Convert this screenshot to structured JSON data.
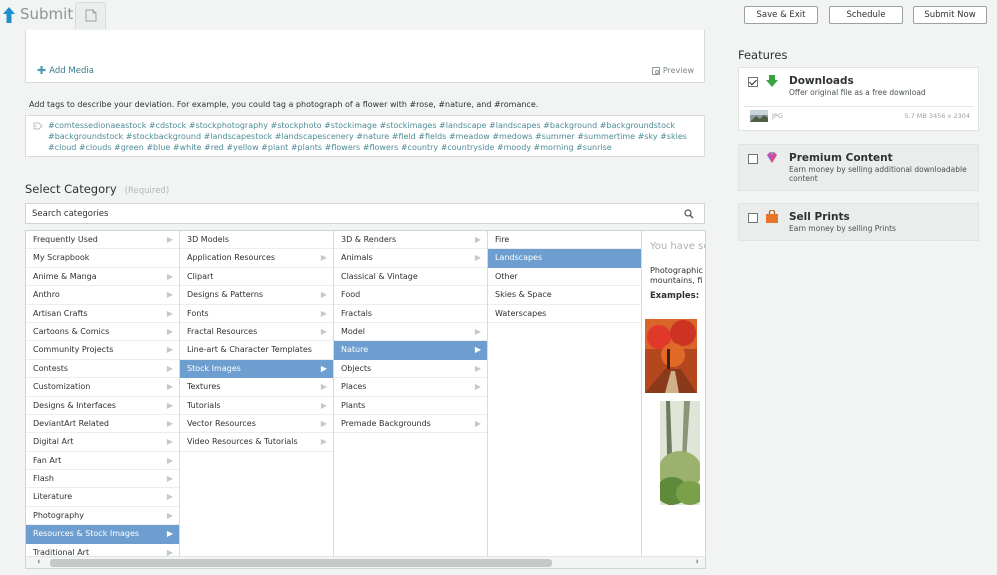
{
  "header": {
    "title": "Submit",
    "buttons": {
      "save_exit": "Save & Exit",
      "schedule": "Schedule",
      "submit_now": "Submit Now"
    }
  },
  "editor": {
    "add_media": "Add Media",
    "preview": "Preview"
  },
  "tags": {
    "hint": "Add tags to describe your deviation. For example, you could tag a photograph of a flower with #rose, #nature, and #romance.",
    "text": "#comtessedionaeastock #cdstock #stockphotography #stockphoto #stockimage #stockimages #landscape #landscapes #background #backgroundstock #backgroundstock #stockbackground #landscapestock #landscapescenery #nature #field #fields #meadow #medows #summer #summertime #sky #skies #cloud #clouds #green #blue #white #red #yellow #plant #plants #flowers #flowers #country #countryside #moody #morning #sunrise"
  },
  "category": {
    "title": "Select Category",
    "required": "(Required)",
    "search_placeholder": "Search categories",
    "col1": [
      {
        "label": "Frequently Used",
        "arrow": true
      },
      {
        "label": "My Scrapbook",
        "arrow": false
      },
      {
        "label": "Anime & Manga",
        "arrow": true
      },
      {
        "label": "Anthro",
        "arrow": true
      },
      {
        "label": "Artisan Crafts",
        "arrow": true
      },
      {
        "label": "Cartoons & Comics",
        "arrow": true
      },
      {
        "label": "Community Projects",
        "arrow": true
      },
      {
        "label": "Contests",
        "arrow": true
      },
      {
        "label": "Customization",
        "arrow": true
      },
      {
        "label": "Designs & Interfaces",
        "arrow": true
      },
      {
        "label": "DeviantArt Related",
        "arrow": true
      },
      {
        "label": "Digital Art",
        "arrow": true
      },
      {
        "label": "Fan Art",
        "arrow": true
      },
      {
        "label": "Flash",
        "arrow": true
      },
      {
        "label": "Literature",
        "arrow": true
      },
      {
        "label": "Photography",
        "arrow": true
      },
      {
        "label": "Resources & Stock Images",
        "arrow": true,
        "selected": true
      },
      {
        "label": "Traditional Art",
        "arrow": true
      }
    ],
    "col2": [
      {
        "label": "3D Models",
        "arrow": false
      },
      {
        "label": "Application Resources",
        "arrow": true
      },
      {
        "label": "Clipart",
        "arrow": false
      },
      {
        "label": "Designs & Patterns",
        "arrow": true
      },
      {
        "label": "Fonts",
        "arrow": true
      },
      {
        "label": "Fractal Resources",
        "arrow": true
      },
      {
        "label": "Line-art & Character Templates",
        "arrow": false
      },
      {
        "label": "Stock Images",
        "arrow": true,
        "selected": true
      },
      {
        "label": "Textures",
        "arrow": true
      },
      {
        "label": "Tutorials",
        "arrow": true
      },
      {
        "label": "Vector Resources",
        "arrow": true
      },
      {
        "label": "Video Resources & Tutorials",
        "arrow": true
      }
    ],
    "col3": [
      {
        "label": "3D & Renders",
        "arrow": true
      },
      {
        "label": "Animals",
        "arrow": true
      },
      {
        "label": "Classical & Vintage",
        "arrow": false
      },
      {
        "label": "Food",
        "arrow": false
      },
      {
        "label": "Fractals",
        "arrow": false
      },
      {
        "label": "Model",
        "arrow": true
      },
      {
        "label": "Nature",
        "arrow": true,
        "selected": true
      },
      {
        "label": "Objects",
        "arrow": true
      },
      {
        "label": "Places",
        "arrow": true
      },
      {
        "label": "Plants",
        "arrow": false
      },
      {
        "label": "Premade Backgrounds",
        "arrow": true
      }
    ],
    "col4": [
      {
        "label": "Fire",
        "arrow": false
      },
      {
        "label": "Landscapes",
        "arrow": false,
        "selected": true
      },
      {
        "label": "Other",
        "arrow": false
      },
      {
        "label": "Skies & Space",
        "arrow": false
      },
      {
        "label": "Waterscapes",
        "arrow": false
      }
    ],
    "info": {
      "heading": "You have se",
      "desc_line1": "Photographic",
      "desc_line2": "mountains, fi",
      "examples": "Examples:"
    }
  },
  "features": {
    "title": "Features",
    "downloads": {
      "name": "Downloads",
      "desc": "Offer original file as a free download",
      "checked": true,
      "file_type": "JPG",
      "file_meta": "5.7 MB  3456 x 2304"
    },
    "premium": {
      "name": "Premium Content",
      "desc": "Earn money by selling additional downloadable content",
      "checked": false
    },
    "prints": {
      "name": "Sell Prints",
      "desc": "Earn money by selling Prints",
      "checked": false
    }
  },
  "colors": {
    "accent": "#6d9ecf",
    "link": "#337d8a",
    "tags": "#4e8b97"
  }
}
